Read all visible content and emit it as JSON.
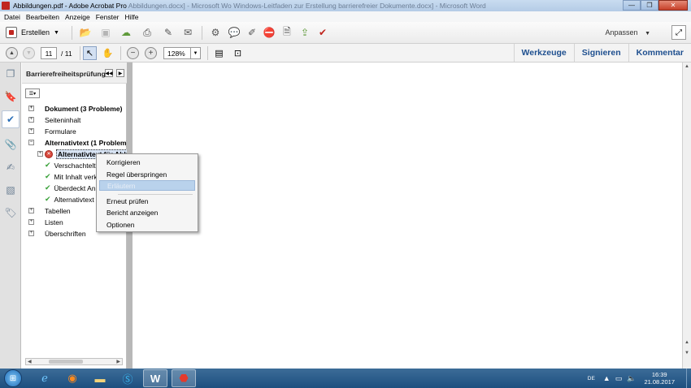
{
  "window": {
    "title_main": "Abbildungen.pdf - Adobe Acrobat Pro",
    "title_background": "Abbildungen.docx] - Microsoft Wo Windows-Leitfaden zur Erstellung barrierefreier Dokumente.docx] - Microsoft Word",
    "minimize": "—",
    "maximize": "❐",
    "close": "✕"
  },
  "menu": [
    "Datei",
    "Bearbeiten",
    "Anzeige",
    "Fenster",
    "Hilfe"
  ],
  "toolbar": {
    "create_label": "Erstellen",
    "customize_label": "Anpassen"
  },
  "nav": {
    "page_current": "11",
    "page_total": "/ 11",
    "zoom": "128%"
  },
  "right_tabs": [
    "Werkzeuge",
    "Signieren",
    "Kommentar"
  ],
  "panel": {
    "title": "Barrierefreiheitsprüfung",
    "tree": [
      {
        "label": "Dokument (3 Probleme)",
        "bold": true,
        "expander": "+"
      },
      {
        "label": "Seiteninhalt",
        "bold": false,
        "expander": "+"
      },
      {
        "label": "Formulare",
        "bold": false,
        "expander": "+"
      },
      {
        "label": "Alternativtext (1 Problem)",
        "bold": true,
        "expander": "−"
      },
      {
        "label": "Alternativtext für Abbildungen",
        "status": "error",
        "selected": true
      },
      {
        "label": "Verschachtelter Alternativtext",
        "status": "pass"
      },
      {
        "label": "Mit Inhalt verknüpft",
        "status": "pass"
      },
      {
        "label": "Überdeckt Anmerkung",
        "status": "pass"
      },
      {
        "label": "Alternativtext für weitere Elemente",
        "status": "pass"
      },
      {
        "label": "Tabellen",
        "bold": false,
        "expander": "+"
      },
      {
        "label": "Listen",
        "bold": false,
        "expander": "+"
      },
      {
        "label": "Überschriften",
        "bold": false,
        "expander": "+"
      }
    ]
  },
  "context_menu": [
    {
      "label": "Korrigieren",
      "highlighted": false
    },
    {
      "label": "Regel überspringen",
      "highlighted": false
    },
    {
      "label": "Erläutern",
      "highlighted": true
    },
    {
      "label": "Erneut prüfen",
      "highlighted": false
    },
    {
      "label": "Bericht anzeigen",
      "highlighted": false
    },
    {
      "label": "Optionen",
      "highlighted": false
    }
  ],
  "taskbar": {
    "apps": [
      "internet-explorer",
      "firefox",
      "file-explorer",
      "skype",
      "word",
      "acrobat"
    ],
    "language": "DE",
    "time": "16:39",
    "date": "21.08.2017"
  },
  "colors": {
    "accent_tabs": "#1e4f8f",
    "error": "#d84a3e",
    "pass": "#3aa23a",
    "selection": "#d8e4f4",
    "menu_highlight": "#b9d2ec"
  }
}
